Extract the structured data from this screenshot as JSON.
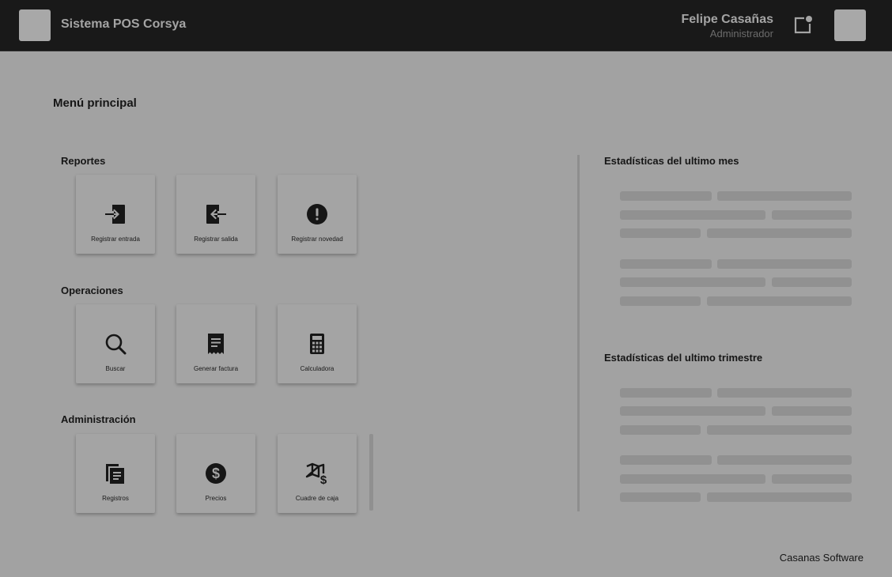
{
  "header": {
    "app_title": "Sistema POS Corsya",
    "user_name": "Felipe Casañas",
    "user_role": "Administrador"
  },
  "main": {
    "title": "Menú principal",
    "sections": [
      {
        "title": "Reportes",
        "items": [
          {
            "label": "Registrar entrada",
            "icon": "login-icon"
          },
          {
            "label": "Registrar salida",
            "icon": "logout-icon"
          },
          {
            "label": "Registrar novedad",
            "icon": "alert-circle-icon"
          }
        ]
      },
      {
        "title": "Operaciones",
        "items": [
          {
            "label": "Buscar",
            "icon": "search-icon"
          },
          {
            "label": "Generar factura",
            "icon": "receipt-icon"
          },
          {
            "label": "Calculadora",
            "icon": "calculator-icon"
          }
        ]
      },
      {
        "title": "Administración",
        "items": [
          {
            "label": "Registros",
            "icon": "documents-icon"
          },
          {
            "label": "Precios",
            "icon": "dollar-circle-icon"
          },
          {
            "label": "Cuadre de caja",
            "icon": "map-dollar-icon"
          }
        ]
      }
    ]
  },
  "stats": {
    "monthly_title": "Estadísticas del ultimo mes",
    "quarterly_title": "Estadísticas del ultimo trimestre"
  },
  "footer": {
    "text": "Casanas Software"
  },
  "colors": {
    "topbar": "#191919",
    "background": "#a2a2a2",
    "card": "#a4a4a4",
    "skeleton": "#919191"
  }
}
